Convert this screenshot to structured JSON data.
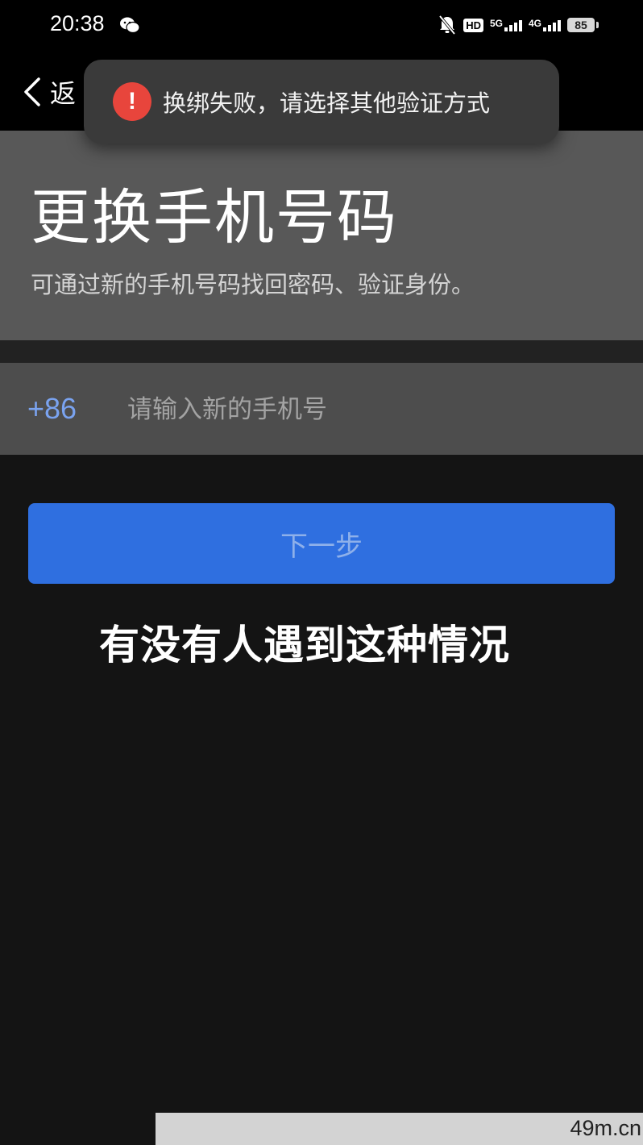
{
  "status_bar": {
    "time": "20:38",
    "hd_label": "HD",
    "net1_label": "5G",
    "net2_label": "4G",
    "battery": "85"
  },
  "nav": {
    "back_label": "返"
  },
  "toast": {
    "icon": "!",
    "message": "换绑失败，请选择其他验证方式",
    "icon_color": "#e8453c"
  },
  "header": {
    "title": "更换手机号码",
    "subtitle": "可通过新的手机号码找回密码、验证身份。"
  },
  "phone": {
    "country_code": "+86",
    "placeholder": "请输入新的手机号",
    "value": ""
  },
  "next_button": {
    "label": "下一步",
    "color": "#2f6fe0"
  },
  "caption": "有没有人遇到这种情况",
  "watermark": "49m.cn"
}
